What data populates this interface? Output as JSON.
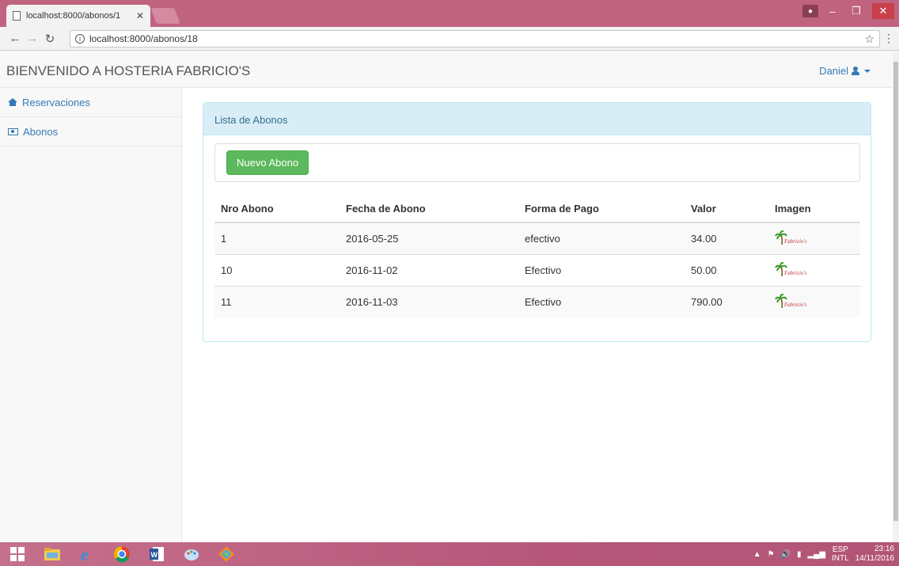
{
  "browser": {
    "tab_title": "localhost:8000/abonos/1",
    "url": "localhost:8000/abonos/18"
  },
  "app": {
    "brand": "BIENVENIDO A HOSTERIA FABRICIO'S",
    "user": "Daniel"
  },
  "sidebar": {
    "items": [
      {
        "label": "Reservaciones",
        "icon": "home-icon"
      },
      {
        "label": "Abonos",
        "icon": "money-icon"
      }
    ]
  },
  "panel": {
    "title": "Lista de Abonos",
    "new_button": "Nuevo Abono"
  },
  "table": {
    "headers": [
      "Nro Abono",
      "Fecha de Abono",
      "Forma de Pago",
      "Valor",
      "Imagen"
    ],
    "rows": [
      {
        "nro": "1",
        "fecha": "2016-05-25",
        "forma": "efectivo",
        "valor": "34.00",
        "imagen": "Fabricio's"
      },
      {
        "nro": "10",
        "fecha": "2016-11-02",
        "forma": "Efectivo",
        "valor": "50.00",
        "imagen": "Fabricio's"
      },
      {
        "nro": "11",
        "fecha": "2016-11-03",
        "forma": "Efectivo",
        "valor": "790.00",
        "imagen": "Fabricio's"
      }
    ]
  },
  "taskbar": {
    "lang_top": "ESP",
    "lang_bottom": "INTL",
    "time": "23:16",
    "date": "14/11/2016"
  },
  "colors": {
    "accent": "#337ab7",
    "success": "#5cb85c",
    "panel_info": "#d9edf7",
    "chrome": "#c0637f"
  }
}
